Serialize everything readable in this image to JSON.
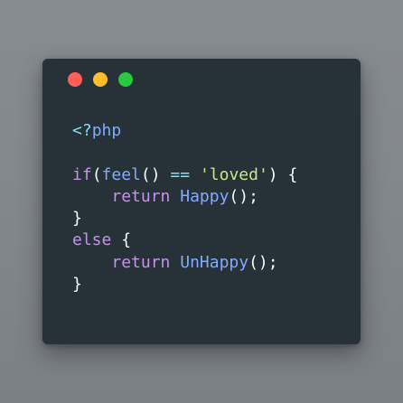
{
  "colors": {
    "close": "#ff5f56",
    "minimize": "#ffbd2e",
    "maximize": "#27c93f",
    "window_bg": "#263238",
    "keyword": "#c792ea",
    "function": "#82aaff",
    "string": "#c3e88d",
    "operator": "#89ddff",
    "plain": "#eeffff"
  },
  "code_lines": [
    [
      {
        "text": "<?",
        "kind": "tag"
      },
      {
        "text": "php",
        "kind": "func"
      }
    ],
    [],
    [
      {
        "text": "if",
        "kind": "keyword"
      },
      {
        "text": "(",
        "kind": "plain"
      },
      {
        "text": "feel",
        "kind": "func"
      },
      {
        "text": "() ",
        "kind": "plain"
      },
      {
        "text": "==",
        "kind": "op"
      },
      {
        "text": " ",
        "kind": "plain"
      },
      {
        "text": "'loved'",
        "kind": "string"
      },
      {
        "text": ") {",
        "kind": "plain"
      }
    ],
    [
      {
        "text": "    ",
        "kind": "plain"
      },
      {
        "text": "return",
        "kind": "keyword"
      },
      {
        "text": " ",
        "kind": "plain"
      },
      {
        "text": "Happy",
        "kind": "func"
      },
      {
        "text": "();",
        "kind": "plain"
      }
    ],
    [
      {
        "text": "}",
        "kind": "plain"
      }
    ],
    [
      {
        "text": "else",
        "kind": "keyword"
      },
      {
        "text": " {",
        "kind": "plain"
      }
    ],
    [
      {
        "text": "    ",
        "kind": "plain"
      },
      {
        "text": "return",
        "kind": "keyword"
      },
      {
        "text": " ",
        "kind": "plain"
      },
      {
        "text": "UnHappy",
        "kind": "func"
      },
      {
        "text": "();",
        "kind": "plain"
      }
    ],
    [
      {
        "text": "}",
        "kind": "plain"
      }
    ]
  ]
}
